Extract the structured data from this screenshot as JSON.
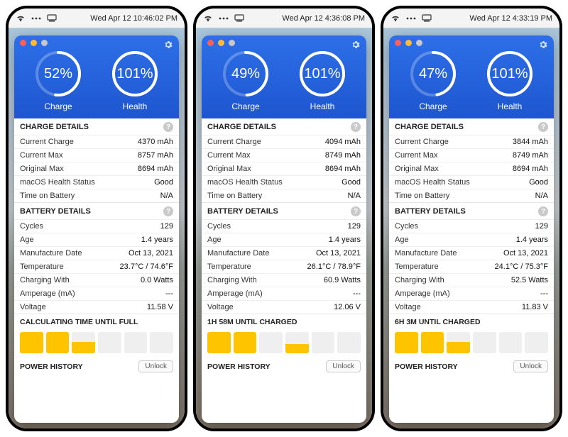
{
  "menubar_icons": [
    "wifi",
    "dots",
    "dock"
  ],
  "panels": [
    {
      "time": "Wed Apr 12  10:46:02 PM",
      "charge_pct": "52%",
      "charge_frac": 0.52,
      "health_pct": "101%",
      "health_frac": 1.0,
      "charge_label": "Charge",
      "health_label": "Health",
      "sect_charge": "CHARGE DETAILS",
      "rows_charge": [
        {
          "lab": "Current Charge",
          "val": "4370 mAh"
        },
        {
          "lab": "Current Max",
          "val": "8757 mAh"
        },
        {
          "lab": "Original Max",
          "val": "8694 mAh"
        },
        {
          "lab": "macOS Health Status",
          "val": "Good"
        },
        {
          "lab": "Time on Battery",
          "val": "N/A"
        }
      ],
      "sect_batt": "BATTERY DETAILS",
      "rows_batt": [
        {
          "lab": "Cycles",
          "val": "129"
        },
        {
          "lab": "Age",
          "val": "1.4 years"
        },
        {
          "lab": "Manufacture Date",
          "val": "Oct 13, 2021"
        },
        {
          "lab": "Temperature",
          "val": "23.7°C / 74.6°F"
        },
        {
          "lab": "Charging With",
          "val": "0.0 Watts"
        },
        {
          "lab": "Amperage (mA)",
          "val": "---"
        },
        {
          "lab": "Voltage",
          "val": "11.58 V"
        }
      ],
      "status": "CALCULATING TIME UNTIL FULL",
      "bars": [
        1.0,
        1.0,
        0.55,
        0.0,
        0.0,
        0.0
      ],
      "footer": "POWER HISTORY",
      "unlock": "Unlock"
    },
    {
      "time": "Wed Apr 12  4:36:08 PM",
      "charge_pct": "49%",
      "charge_frac": 0.49,
      "health_pct": "101%",
      "health_frac": 1.0,
      "charge_label": "Charge",
      "health_label": "Health",
      "sect_charge": "CHARGE DETAILS",
      "rows_charge": [
        {
          "lab": "Current Charge",
          "val": "4094 mAh"
        },
        {
          "lab": "Current Max",
          "val": "8749 mAh"
        },
        {
          "lab": "Original Max",
          "val": "8694 mAh"
        },
        {
          "lab": "macOS Health Status",
          "val": "Good"
        },
        {
          "lab": "Time on Battery",
          "val": "N/A"
        }
      ],
      "sect_batt": "BATTERY DETAILS",
      "rows_batt": [
        {
          "lab": "Cycles",
          "val": "129"
        },
        {
          "lab": "Age",
          "val": "1.4 years"
        },
        {
          "lab": "Manufacture Date",
          "val": "Oct 13, 2021"
        },
        {
          "lab": "Temperature",
          "val": "26.1°C / 78.9°F"
        },
        {
          "lab": "Charging With",
          "val": "60.9 Watts"
        },
        {
          "lab": "Amperage (mA)",
          "val": "---"
        },
        {
          "lab": "Voltage",
          "val": "12.06 V"
        }
      ],
      "status": "1H 58M UNTIL CHARGED",
      "bars": [
        1.0,
        1.0,
        0.0,
        0.45,
        0.0,
        0.0
      ],
      "footer": "POWER HISTORY",
      "unlock": "Unlock"
    },
    {
      "time": "Wed Apr 12  4:33:19 PM",
      "charge_pct": "47%",
      "charge_frac": 0.47,
      "health_pct": "101%",
      "health_frac": 1.0,
      "charge_label": "Charge",
      "health_label": "Health",
      "sect_charge": "CHARGE DETAILS",
      "rows_charge": [
        {
          "lab": "Current Charge",
          "val": "3844 mAh"
        },
        {
          "lab": "Current Max",
          "val": "8749 mAh"
        },
        {
          "lab": "Original Max",
          "val": "8694 mAh"
        },
        {
          "lab": "macOS Health Status",
          "val": "Good"
        },
        {
          "lab": "Time on Battery",
          "val": "N/A"
        }
      ],
      "sect_batt": "BATTERY DETAILS",
      "rows_batt": [
        {
          "lab": "Cycles",
          "val": "129"
        },
        {
          "lab": "Age",
          "val": "1.4 years"
        },
        {
          "lab": "Manufacture Date",
          "val": "Oct 13, 2021"
        },
        {
          "lab": "Temperature",
          "val": "24.1°C / 75.3°F"
        },
        {
          "lab": "Charging With",
          "val": "52.5 Watts"
        },
        {
          "lab": "Amperage (mA)",
          "val": "---"
        },
        {
          "lab": "Voltage",
          "val": "11.83 V"
        }
      ],
      "status": "6H 3M UNTIL CHARGED",
      "bars": [
        1.0,
        1.0,
        0.55,
        0.0,
        0.0,
        0.0
      ],
      "footer": "POWER HISTORY",
      "unlock": "Unlock"
    }
  ]
}
